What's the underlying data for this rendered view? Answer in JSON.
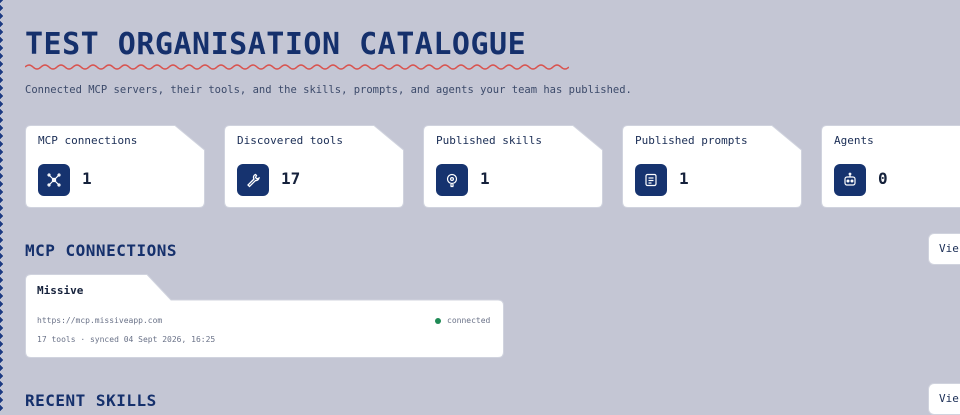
{
  "page": {
    "title": "TEST ORGANISATION CATALOGUE",
    "subtitle": "Connected MCP servers, their tools, and the skills, prompts, and agents your team has published."
  },
  "stats": [
    {
      "label": "MCP connections",
      "value": "1",
      "icon": "network-icon"
    },
    {
      "label": "Discovered tools",
      "value": "17",
      "icon": "wrench-icon"
    },
    {
      "label": "Published skills",
      "value": "1",
      "icon": "bulb-icon"
    },
    {
      "label": "Published prompts",
      "value": "1",
      "icon": "document-icon"
    },
    {
      "label": "Agents",
      "value": "0",
      "icon": "robot-icon"
    }
  ],
  "sections": {
    "mcp": {
      "title": "MCP CONNECTIONS",
      "view_label": "Vie"
    },
    "skills": {
      "title": "RECENT SKILLS",
      "view_label": "Vie"
    }
  },
  "connection": {
    "name": "Missive",
    "url": "https://mcp.missiveapp.com",
    "status": "connected",
    "meta": "17 tools · synced 04 Sept 2026, 16:25"
  },
  "colors": {
    "background": "#c4c6d4",
    "accent": "#16336f",
    "status_ok": "#1f8a55",
    "squiggle": "#d9534f"
  }
}
